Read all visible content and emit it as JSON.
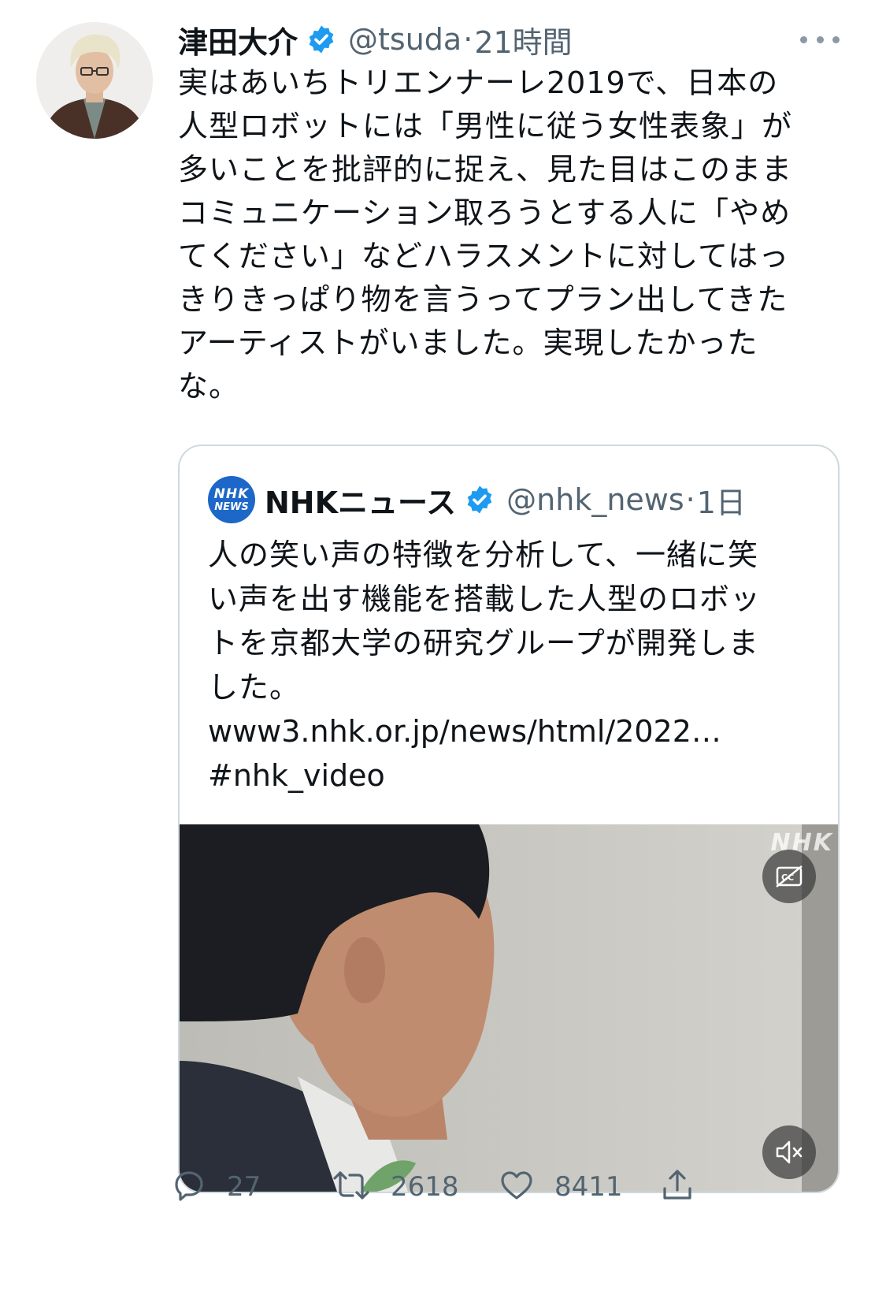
{
  "tweet": {
    "author": {
      "display_name": "津田大介",
      "handle": "@tsuda",
      "verified": true
    },
    "separator": "·",
    "timestamp": "21時間",
    "text_lines": [
      "実はあいちトリエンナーレ2019で、日本の",
      "人型ロボットには「男性に従う女性表象」が",
      "多いことを批評的に捉え、見た目はこのまま",
      "コミュニケーション取ろうとする人に「やめ",
      "てください」などハラスメントに対してはっ",
      "きりきっぱり物を言うってプラン出してきた",
      "アーティストがいました。実現したかった",
      "な。"
    ],
    "quoted": {
      "avatar_lines": [
        "NHK",
        "NEWS"
      ],
      "display_name": "NHKニュース",
      "handle": "@nhk_news",
      "verified": true,
      "separator": "·",
      "timestamp": "1日",
      "text_lines": [
        "人の笑い声の特徴を分析して、一緒に笑",
        "い声を出す機能を搭載した人型のロボッ",
        "トを京都大学の研究グループが開発しま",
        "した。"
      ],
      "link": "www3.nhk.or.jp/news/html/2022…",
      "hashtag": "#nhk_video",
      "media": {
        "watermark": "NHK",
        "cc_icon": "closed-captions-icon",
        "mute_icon": "speaker-muted-icon"
      }
    },
    "actions": {
      "reply_count": "27",
      "retweet_count": "2618",
      "like_count": "8411"
    },
    "colors": {
      "verified_blue": "#1d9bf0",
      "secondary_text": "#536471",
      "border": "#cfd9de",
      "nhk_blue": "#1c67c8"
    }
  }
}
